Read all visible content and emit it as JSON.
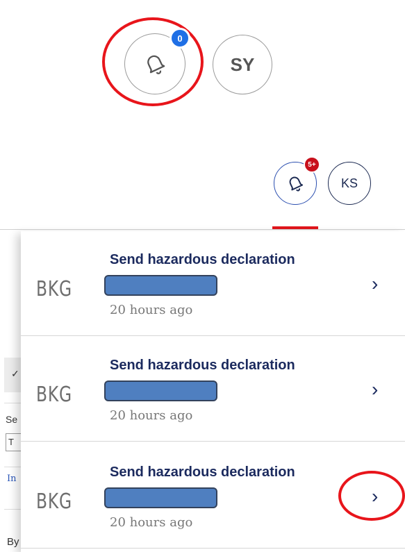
{
  "top_header": {
    "bell_badge": "0",
    "avatar_initials": "SY",
    "bell_icon": "bell-icon",
    "highlight_color": "#e8151b"
  },
  "nav_header": {
    "bell_badge": "5+",
    "avatar_initials": "KS",
    "bell_icon": "bell-icon"
  },
  "background_page": {
    "fragments": [
      "Se",
      "T",
      "In",
      "By"
    ]
  },
  "notifications": [
    {
      "sender_logo": "BKG",
      "title": "Send hazardous declaration",
      "time": "20 hours ago"
    },
    {
      "sender_logo": "BKG",
      "title": "Send hazardous declaration",
      "time": "20 hours ago"
    },
    {
      "sender_logo": "BKG",
      "title": "Send hazardous declaration",
      "time": "20 hours ago"
    }
  ],
  "colors": {
    "accent_red": "#e1161c",
    "badge_blue": "#1f6fe5",
    "badge_red": "#c8101c",
    "navy": "#1b2a5e",
    "redaction": "#4f7fc0"
  }
}
